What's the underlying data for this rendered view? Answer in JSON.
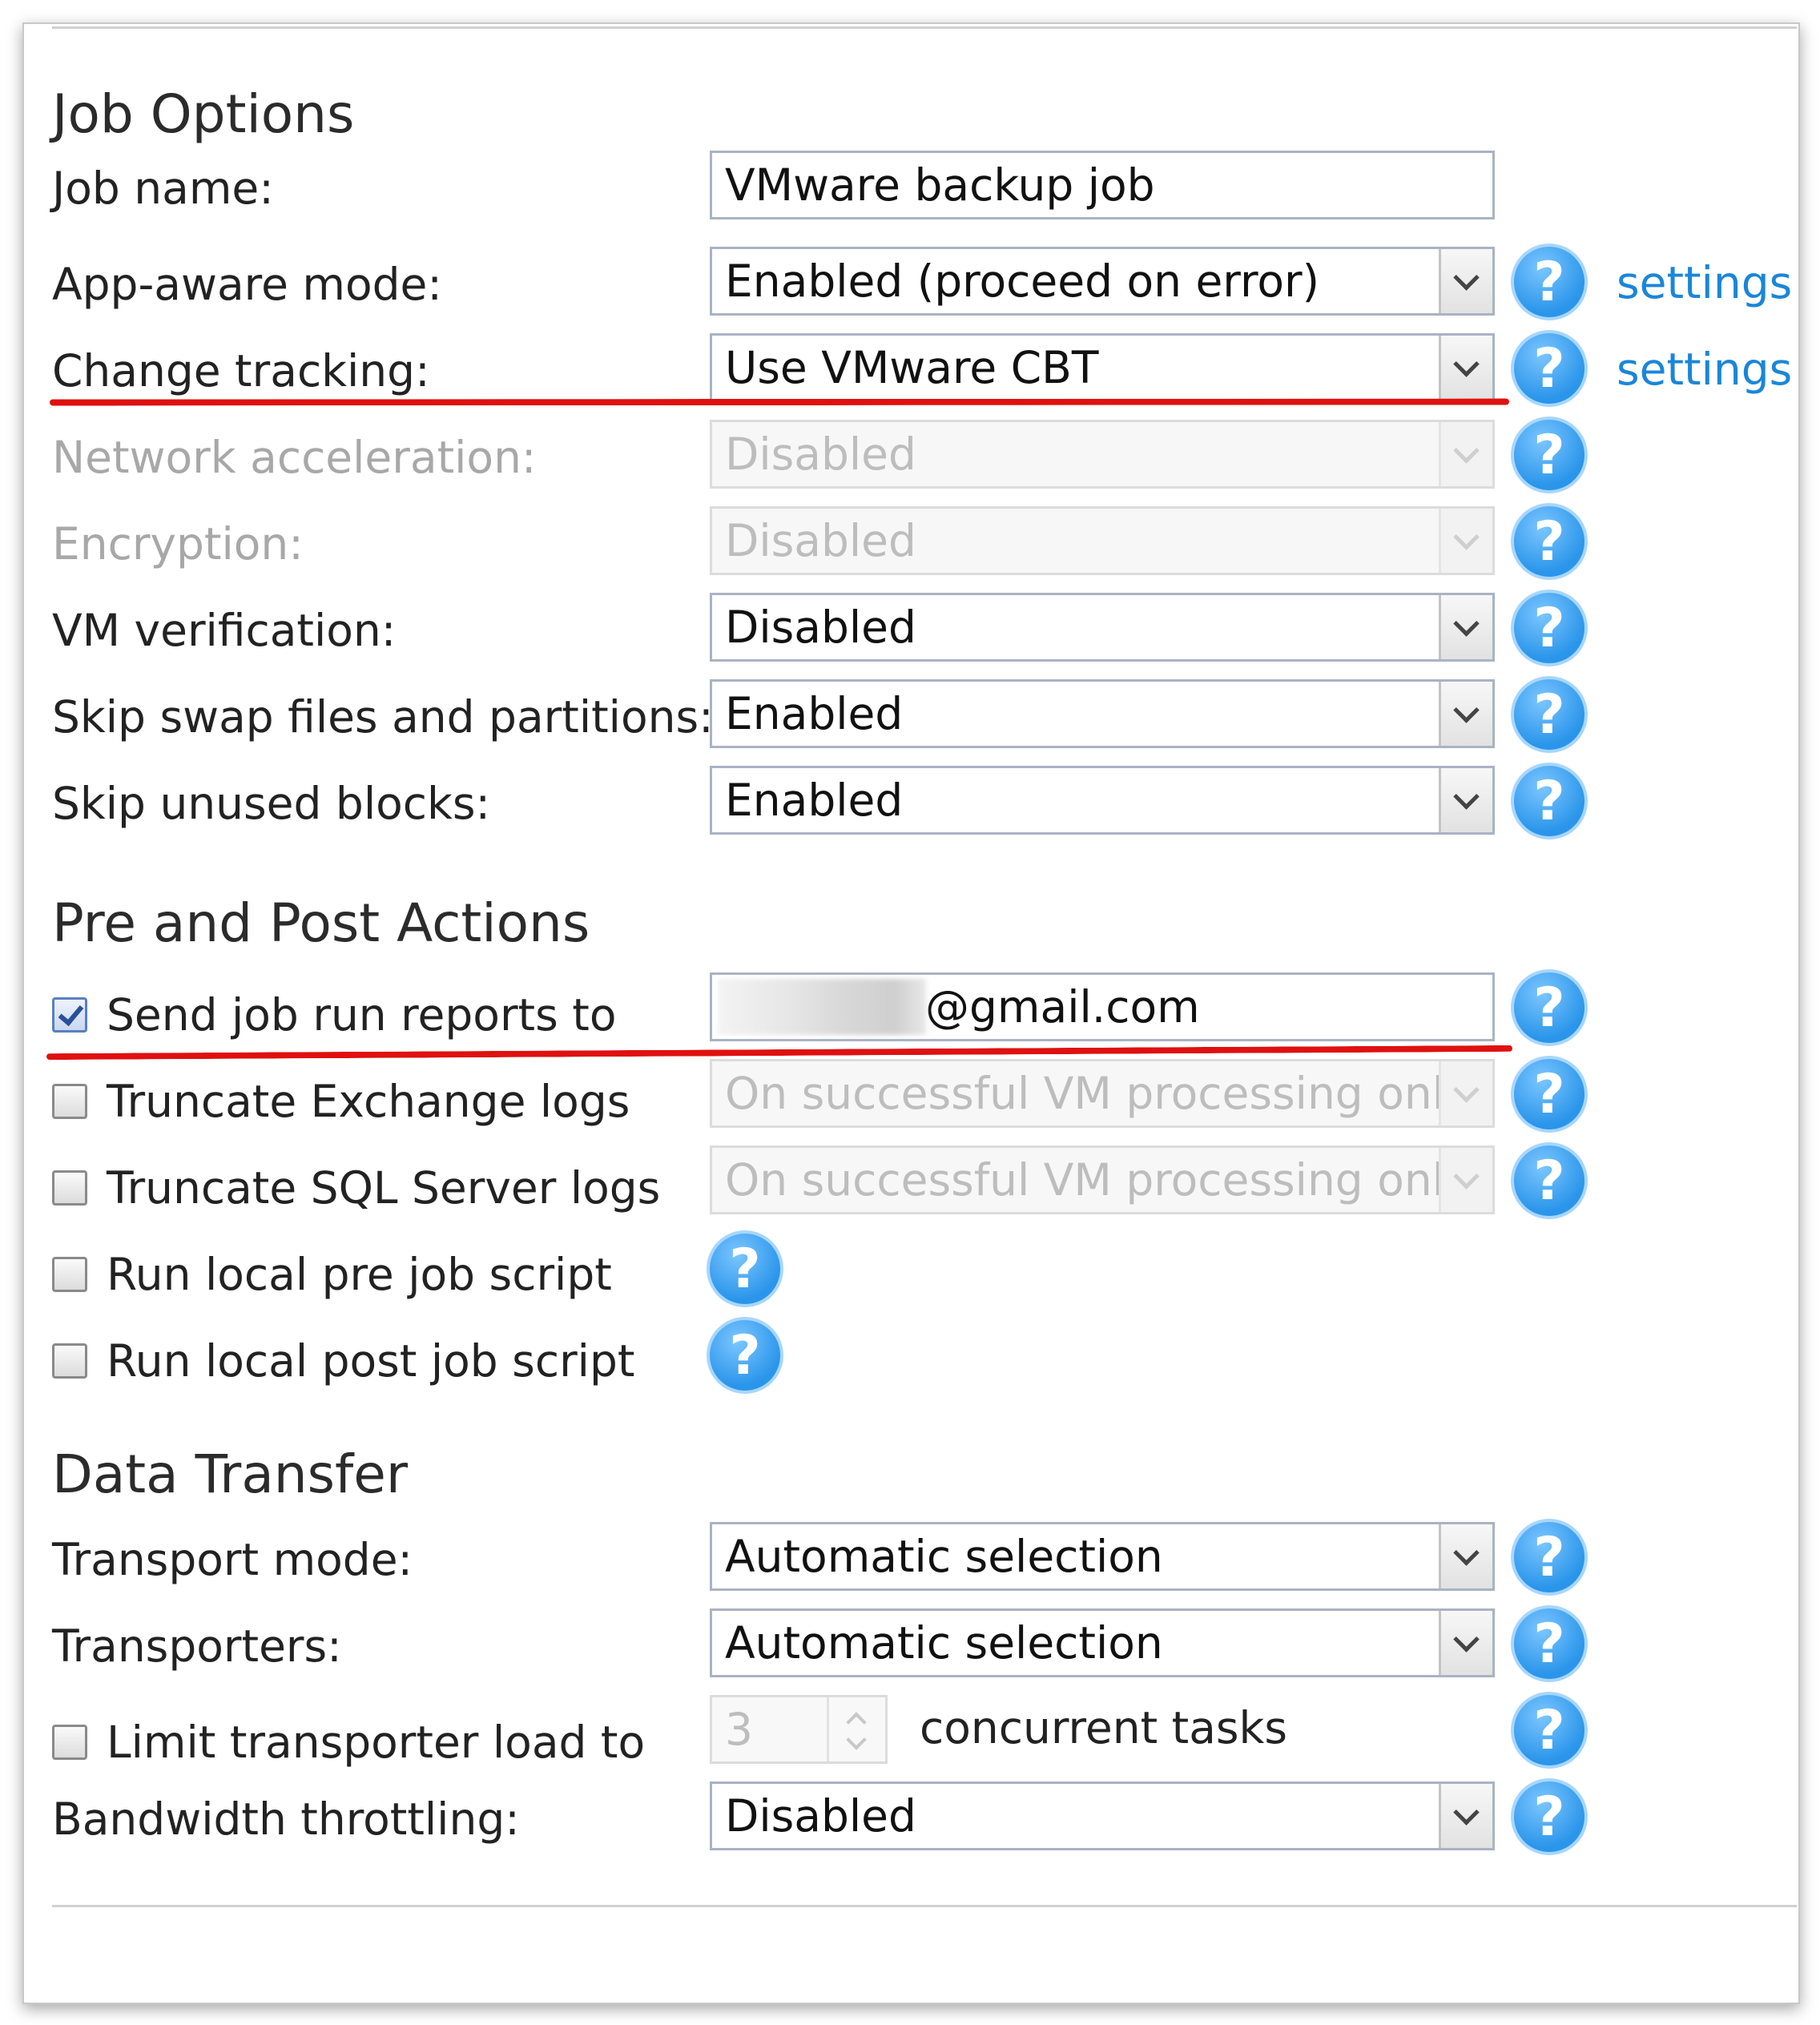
{
  "sections": {
    "job_options": "Job Options",
    "pre_post": "Pre and Post Actions",
    "data_transfer": "Data Transfer"
  },
  "job_options": {
    "job_name": {
      "label": "Job name:",
      "value": "VMware backup job"
    },
    "app_aware": {
      "label": "App-aware mode:",
      "value": "Enabled (proceed on error)",
      "link": "settings"
    },
    "change_tracking": {
      "label": "Change tracking:",
      "value": "Use VMware CBT",
      "link": "settings"
    },
    "network_accel": {
      "label": "Network acceleration:",
      "value": "Disabled"
    },
    "encryption": {
      "label": "Encryption:",
      "value": "Disabled"
    },
    "vm_verification": {
      "label": "VM verification:",
      "value": "Disabled"
    },
    "skip_swap": {
      "label": "Skip swap files and partitions:",
      "value": "Enabled"
    },
    "skip_unused": {
      "label": "Skip unused blocks:",
      "value": "Enabled"
    }
  },
  "pre_post": {
    "send_reports": {
      "label": "Send job run reports to",
      "checked": true,
      "value": "@gmail.com"
    },
    "truncate_exchange": {
      "label": "Truncate Exchange logs",
      "checked": false,
      "value": "On successful VM processing only"
    },
    "truncate_sql": {
      "label": "Truncate SQL Server logs",
      "checked": false,
      "value": "On successful VM processing only"
    },
    "pre_script": {
      "label": "Run local pre job script",
      "checked": false
    },
    "post_script": {
      "label": "Run local post job script",
      "checked": false
    }
  },
  "data_transfer": {
    "transport_mode": {
      "label": "Transport mode:",
      "value": "Automatic selection"
    },
    "transporters": {
      "label": "Transporters:",
      "value": "Automatic selection"
    },
    "limit_load": {
      "label": "Limit transporter load to",
      "checked": false,
      "value": "3",
      "suffix": "concurrent tasks"
    },
    "bandwidth": {
      "label": "Bandwidth throttling:",
      "value": "Disabled"
    }
  },
  "icons": {
    "help": "help-question-icon",
    "dropdown": "chevron-down-icon"
  },
  "colors": {
    "link": "#1a86d8",
    "help_icon": "#2a95ea",
    "annotation": "#e01010"
  }
}
